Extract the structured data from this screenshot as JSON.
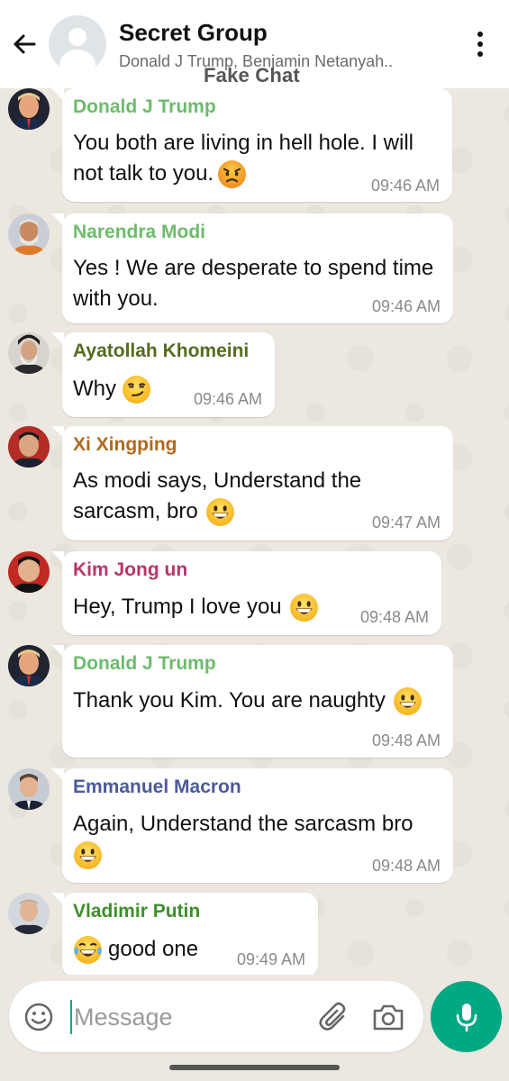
{
  "header": {
    "title": "Secret Group",
    "members": "Donald J Trump, Benjamin Netanyah..",
    "watermark": "Fake Chat"
  },
  "messages": [
    {
      "sender": "Donald J Trump",
      "text": "You both are living in hell hole. I will not talk to you.",
      "emoji": "angry-face",
      "time": "09:46 AM",
      "color": "#6dbb6d",
      "avatar": "trump"
    },
    {
      "sender": "Narendra Modi",
      "text": "Yes ! We are desperate to spend time with you.",
      "emoji": "",
      "time": "09:46 AM",
      "color": "#6dbb6d",
      "avatar": "modi"
    },
    {
      "sender": "Ayatollah Khomeini",
      "text": "Why",
      "emoji": "smirking-face",
      "time": "09:46 AM",
      "color": "#556b1f",
      "avatar": "khomeini"
    },
    {
      "sender": "Xi Xingping",
      "text": "As modi says, Understand the sarcasm, bro",
      "emoji": "grinning-face",
      "time": "09:47 AM",
      "color": "#b06a1e",
      "avatar": "xi"
    },
    {
      "sender": "Kim Jong un",
      "text": "Hey, Trump I love you",
      "emoji": "grinning-face",
      "time": "09:48 AM",
      "color": "#b8356b",
      "avatar": "kim"
    },
    {
      "sender": "Donald J Trump",
      "text": "Thank you Kim. You are naughty",
      "emoji": "grinning-face",
      "time": "09:48 AM",
      "color": "#6dbb6d",
      "avatar": "trump"
    },
    {
      "sender": "Emmanuel Macron",
      "text": "Again, Understand the sarcasm bro",
      "emoji": "grinning-face",
      "time": "09:48 AM",
      "color": "#4a5a9c",
      "avatar": "macron"
    },
    {
      "sender": "Vladimir Putin",
      "text": "good one",
      "emoji": "tears-of-joy-face",
      "time": "09:49 AM",
      "color": "#3d8f2a",
      "avatar": "putin"
    }
  ],
  "composer": {
    "placeholder": "Message",
    "value": ""
  },
  "colors": {
    "accent": "#00a884",
    "bubble": "#ffffff",
    "background": "#ece7df"
  },
  "icons": [
    "back-arrow-icon",
    "default-group-avatar-icon",
    "more-vertical-icon",
    "emoji-icon",
    "paperclip-icon",
    "camera-icon",
    "microphone-icon"
  ]
}
